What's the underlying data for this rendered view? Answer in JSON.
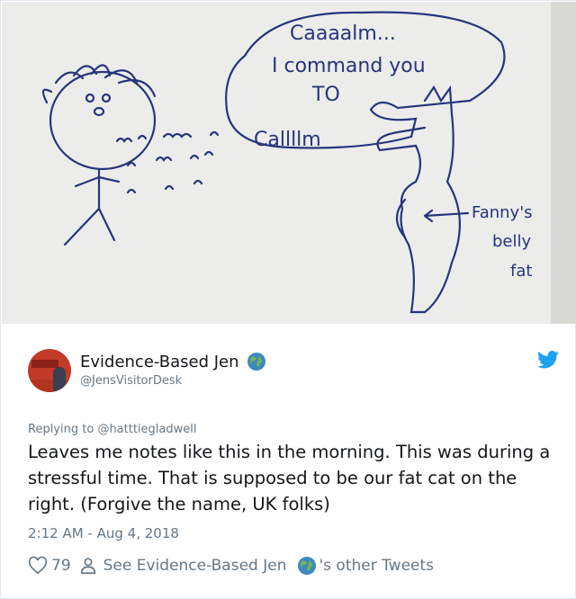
{
  "photo": {
    "note_speech": [
      "Caaaalm...",
      "I command you",
      "TO",
      "Callllm"
    ],
    "note_label": [
      "Fanny's",
      "belly",
      "fat"
    ]
  },
  "tweet": {
    "display_name": "Evidence-Based Jen",
    "handle": "@JensVisitorDesk",
    "replying_prefix": "Replying to",
    "replying_to": "@hatttiegladwell",
    "text": "Leaves me notes like this in the morning. This was during a stressful time. That is supposed to be our fat cat on the right. (Forgive the name, UK folks)",
    "timestamp": "2:12 AM - Aug 4, 2018",
    "likes": "79",
    "see_label": "See Evidence-Based Jen",
    "other_tweets_label": "'s other Tweets"
  },
  "colors": {
    "twitter_blue": "#1da1f2",
    "secondary_text": "#657786",
    "ink": "#27357c"
  },
  "icons": [
    "globe-icon",
    "twitter-bird-icon",
    "heart-icon",
    "person-icon"
  ]
}
